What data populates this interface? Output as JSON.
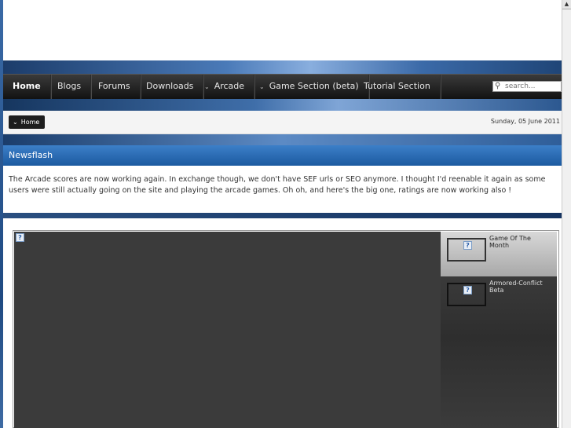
{
  "nav": {
    "items": [
      {
        "label": "Home",
        "dropdown": false,
        "active": true
      },
      {
        "label": "Blogs",
        "dropdown": false,
        "active": false
      },
      {
        "label": "Forums",
        "dropdown": false,
        "active": false
      },
      {
        "label": "Downloads",
        "dropdown": false,
        "active": false
      },
      {
        "label": "Arcade",
        "dropdown": true,
        "active": false
      },
      {
        "label": "Game Section (beta)",
        "dropdown": true,
        "active": false
      },
      {
        "label": "Tutorial Section",
        "dropdown": false,
        "active": false
      }
    ],
    "search_placeholder": "search..."
  },
  "breadcrumb": {
    "label": "Home"
  },
  "date": "Sunday, 05 June 2011",
  "newsflash": {
    "title": "Newsflash",
    "body": "The Arcade scores are now working again. In exchange though, we don't have SEF urls or SEO anymore. I thought I'd reenable it again as some users were still actually going on the site and playing the arcade games. Oh oh, and here's the big one, ratings are now working also !"
  },
  "games": [
    {
      "label": "Game Of The Month"
    },
    {
      "label": "Armored-Conflict Beta"
    }
  ],
  "icons": {
    "broken_image": "?",
    "chevron": "⌄",
    "search": "⚲",
    "scroll_up": "▲"
  }
}
